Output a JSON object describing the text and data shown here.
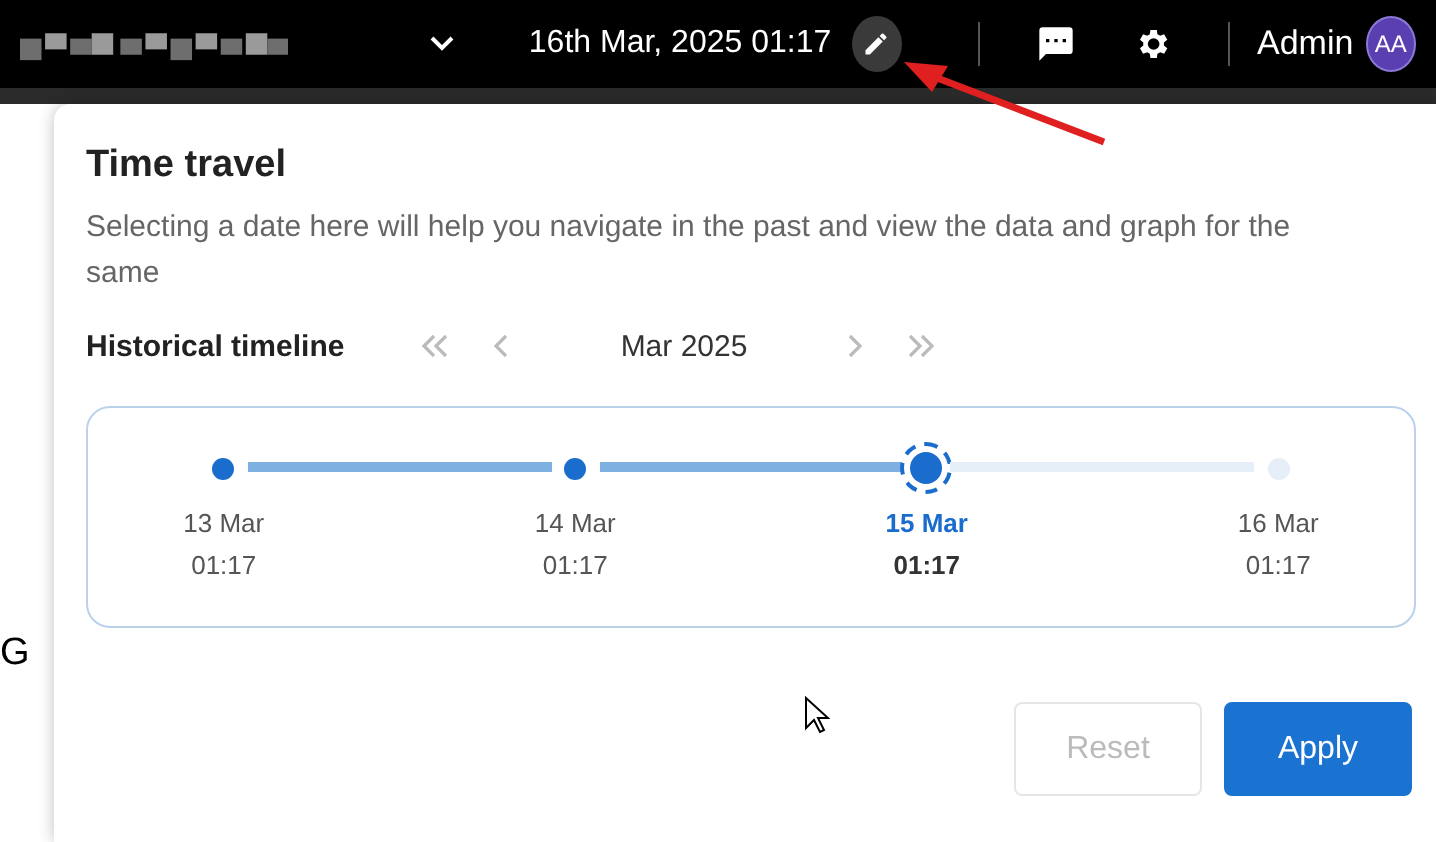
{
  "header": {
    "datetime": "16th Mar, 2025 01:17",
    "user": "Admin",
    "avatar": "AA"
  },
  "background": {
    "fragment": "G"
  },
  "time_travel": {
    "title": "Time travel",
    "description": "Selecting a date here will help you navigate in the past and view the data and graph for the same",
    "timeline_label": "Historical timeline",
    "month": "Mar 2025",
    "points": [
      {
        "date": "13 Mar",
        "time": "01:17",
        "reached": true,
        "selected": false
      },
      {
        "date": "14 Mar",
        "time": "01:17",
        "reached": true,
        "selected": false
      },
      {
        "date": "15 Mar",
        "time": "01:17",
        "reached": true,
        "selected": true
      },
      {
        "date": "16 Mar",
        "time": "01:17",
        "reached": false,
        "selected": false
      }
    ],
    "buttons": [
      {
        "label": "Reset",
        "disabled": true
      },
      {
        "label": "Apply",
        "disabled": false
      }
    ]
  }
}
